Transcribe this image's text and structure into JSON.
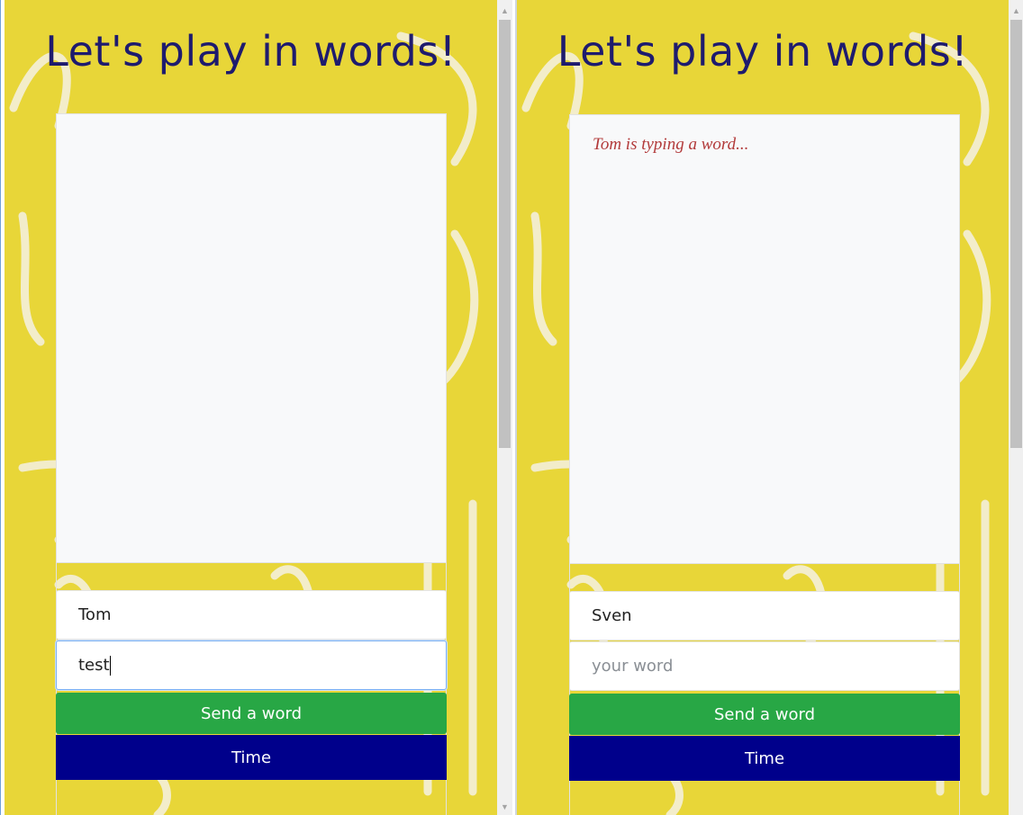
{
  "title": "Let's play in words!",
  "left": {
    "typing_text": "",
    "name_value": "Tom",
    "word_value": "test",
    "word_placeholder": "your word",
    "send_label": "Send a word",
    "time_label": "Time"
  },
  "right": {
    "typing_text": "Tom is typing a word...",
    "name_value": "Sven",
    "word_value": "",
    "word_placeholder": "your word",
    "send_label": "Send a word",
    "time_label": "Time"
  },
  "colors": {
    "background": "#e8d638",
    "title": "#1e1b6e",
    "send_button": "#28a745",
    "time_button": "#00008b",
    "typing_text": "#b23a3a"
  },
  "icons": {
    "scroll_up": "triangle-up-icon",
    "scroll_down": "triangle-down-icon"
  }
}
